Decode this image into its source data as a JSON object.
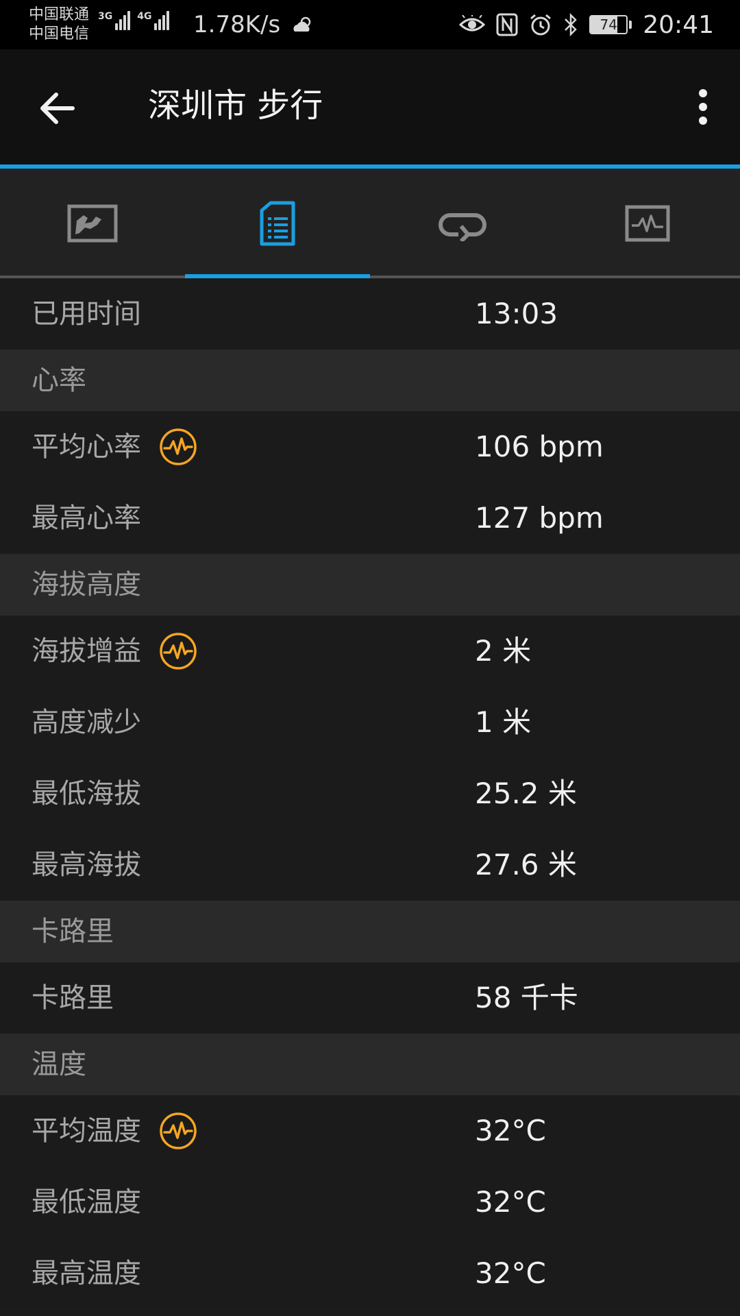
{
  "status_bar": {
    "carrier_1": "中国联通",
    "carrier_2": "中国电信",
    "net_1": "3G",
    "net_2": "4G",
    "speed": "1.78K/s",
    "battery": "74",
    "battery_level": 0.74,
    "time": "20:41",
    "icons": [
      "weather-icon",
      "eye-icon",
      "nfc-icon",
      "alarm-icon",
      "bluetooth-icon",
      "battery-icon"
    ]
  },
  "app_bar": {
    "title": "深圳市 步行",
    "back_icon": "arrow-left-icon",
    "menu_icon": "more-vertical-icon"
  },
  "tabs": [
    {
      "icon": "map-icon",
      "active": false
    },
    {
      "icon": "document-list-icon",
      "active": true
    },
    {
      "icon": "laps-icon",
      "active": false
    },
    {
      "icon": "chart-icon",
      "active": false
    }
  ],
  "colors": {
    "accent": "#1a9fe0",
    "icon_orange": "#f5a623"
  },
  "stats": {
    "elapsed_time": {
      "label": "已用时间",
      "value": "13:03"
    },
    "heart_rate_header": "心率",
    "avg_hr": {
      "label": "平均心率",
      "value": "106 bpm"
    },
    "max_hr": {
      "label": "最高心率",
      "value": "127 bpm"
    },
    "elevation_header": "海拔高度",
    "elev_gain": {
      "label": "海拔增益",
      "value": "2 米"
    },
    "elev_loss": {
      "label": "高度减少",
      "value": "1 米"
    },
    "min_elev": {
      "label": "最低海拔",
      "value": "25.2 米"
    },
    "max_elev": {
      "label": "最高海拔",
      "value": "27.6 米"
    },
    "calories_header": "卡路里",
    "calories": {
      "label": "卡路里",
      "value": "58 千卡"
    },
    "temperature_header": "温度",
    "avg_temp": {
      "label": "平均温度",
      "value": "32°C"
    },
    "min_temp": {
      "label": "最低温度",
      "value": "32°C"
    },
    "max_temp": {
      "label": "最高温度",
      "value": "32°C"
    }
  }
}
